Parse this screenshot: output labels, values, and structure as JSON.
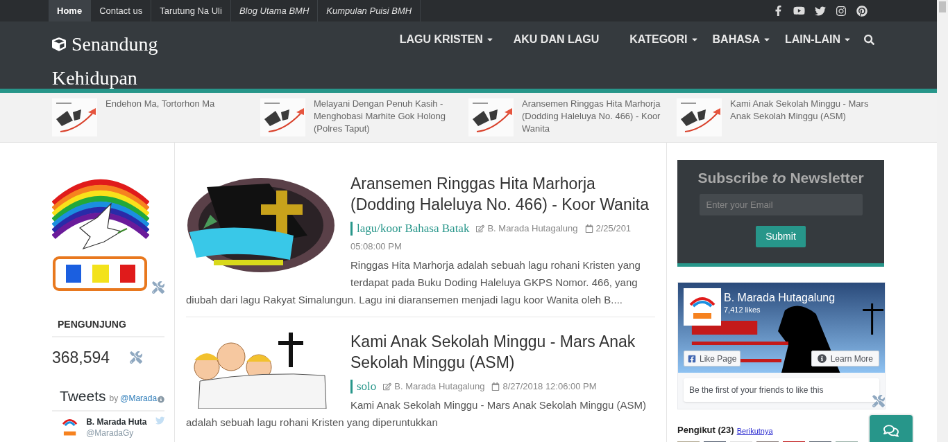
{
  "top_menu": [
    {
      "label": "Home",
      "selected": true,
      "kind": "page"
    },
    {
      "label": "Contact us",
      "selected": false,
      "kind": "page"
    },
    {
      "label": "Tarutung Na Uli",
      "selected": false,
      "kind": "page"
    },
    {
      "label": "Blog Utama BMH",
      "selected": false,
      "kind": "external"
    },
    {
      "label": "Kumpulan Puisi BMH",
      "selected": false,
      "kind": "external"
    }
  ],
  "site_title": "Senandung Kehidupan",
  "main_menu": [
    {
      "label": "LAGU KRISTEN",
      "dropdown": true
    },
    {
      "label": "AKU DAN LAGU",
      "dropdown": false
    },
    {
      "label": "KATEGORI",
      "dropdown": true
    },
    {
      "label": "BAHASA",
      "dropdown": true
    },
    {
      "label": "LAIN-LAIN",
      "dropdown": true
    }
  ],
  "recent_posts": [
    {
      "title": "Endehon Ma, Tortorhon Ma"
    },
    {
      "title": "Melayani Dengan Penuh Kasih - Menghobasi Marhite Gok Holong (Polres Taput)"
    },
    {
      "title": "Aransemen Ringgas Hita Marhorja (Dodding Haleluya No. 466) - Koor Wanita"
    },
    {
      "title": "Kami Anak Sekolah Minggu - Mars Anak Sekolah Minggu (ASM)"
    }
  ],
  "visitors": {
    "title": "PENGUNJUNG",
    "count": "368,594"
  },
  "tweets": {
    "title": "Tweets",
    "by": "by",
    "handle": "@Marada",
    "author": "B. Marada Huta",
    "author_handle": "@MaradaGy"
  },
  "posts": [
    {
      "kind": "book",
      "title": "Aransemen Ringgas Hita Marhorja (Dodding Haleluya No. 466) - Koor Wanita",
      "category": "lagu/koor Bahasa Batak",
      "author": "B. Marada Hutagalung",
      "date": "2/25/201",
      "time": "05:08:00 PM",
      "excerpt": "Ringgas Hita Marhorja adalah sebuah lagu rohani Kristen yang terdapat pada Buku Doding Haleluya GKPS Nomor. 466, yang diubah dari lagu Rakyat Simalungun. Lagu ini diaransemen menjadi lagu koor Wanita oleh B...."
    },
    {
      "kind": "kids",
      "title": "Kami Anak Sekolah Minggu - Mars Anak Sekolah Minggu (ASM)",
      "category": "solo",
      "author": "B. Marada Hutagalung",
      "date": "8/27/2018 12:06:00 PM",
      "excerpt": "Kami Anak Sekolah Minggu - Mars Anak Sekolah Minggu (ASM) adalah sebuah lagu rohani Kristen yang diperuntukkan"
    }
  ],
  "newsletter": {
    "title": "Subscribe *to* Newsletter",
    "placeholder": "Enter your Email",
    "button": "Submit"
  },
  "facebook": {
    "name": "B. Marada Hutagalung",
    "likes": "7,412 likes",
    "like_button": "Like Page",
    "learn_more": "Learn More",
    "friends_text": "Be the first of your friends to like this"
  },
  "followers": {
    "title": "Pengikut (23)",
    "link": "Berikutnya"
  }
}
